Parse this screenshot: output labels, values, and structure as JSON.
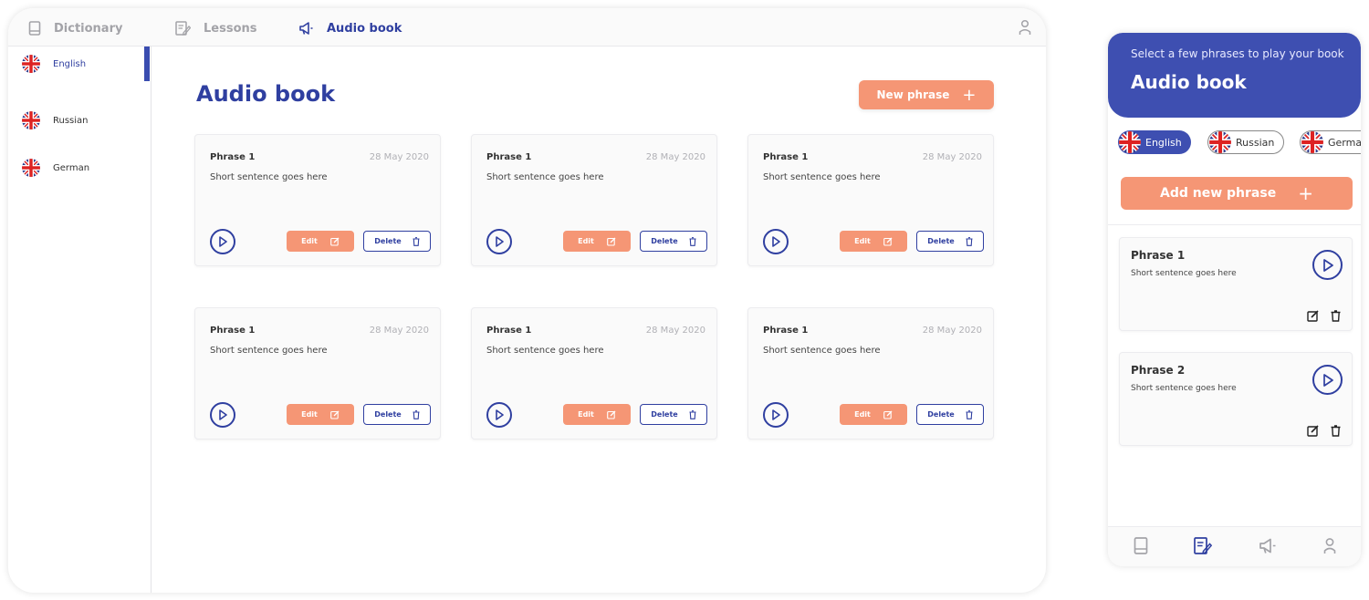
{
  "colors": {
    "brand": "#2f3fa0",
    "accent": "#f59675",
    "muted": "#a3a3a8",
    "mobile_header": "#3e4fb1"
  },
  "desktop": {
    "nav": [
      {
        "label": "Dictionary",
        "icon": "book-icon"
      },
      {
        "label": "Lessons",
        "icon": "edit-note-icon"
      },
      {
        "label": "Audio book",
        "icon": "megaphone-icon"
      }
    ],
    "user_icon": "user-icon",
    "sidebar": [
      {
        "label": "English",
        "icon": "uk-flag-icon"
      },
      {
        "label": "Russian",
        "icon": "uk-flag-icon"
      },
      {
        "label": "German",
        "icon": "uk-flag-icon"
      }
    ],
    "page_title": "Audio book",
    "new_button": "New phrase",
    "cards": [
      {
        "title": "Phrase 1",
        "date": "28 May 2020",
        "text": "Short sentence goes here",
        "edit": "Edit",
        "delete": "Delete"
      },
      {
        "title": "Phrase 1",
        "date": "28 May 2020",
        "text": "Short sentence goes here",
        "edit": "Edit",
        "delete": "Delete"
      },
      {
        "title": "Phrase 1",
        "date": "28 May 2020",
        "text": "Short sentence goes here",
        "edit": "Edit",
        "delete": "Delete"
      },
      {
        "title": "Phrase 1",
        "date": "28 May 2020",
        "text": "Short sentence goes here",
        "edit": "Edit",
        "delete": "Delete"
      },
      {
        "title": "Phrase 1",
        "date": "28 May 2020",
        "text": "Short sentence goes here",
        "edit": "Edit",
        "delete": "Delete"
      },
      {
        "title": "Phrase 1",
        "date": "28 May 2020",
        "text": "Short sentence goes here",
        "edit": "Edit",
        "delete": "Delete"
      }
    ]
  },
  "mobile": {
    "subtitle": "Select a few phrases to play your book",
    "title": "Audio book",
    "chips": [
      "English",
      "Russian",
      "Germa"
    ],
    "add_button": "Add new phrase",
    "cards": [
      {
        "title": "Phrase 1",
        "text": "Short sentence goes here"
      },
      {
        "title": "Phrase 2",
        "text": "Short sentence goes here"
      }
    ],
    "tabs": [
      "book-icon",
      "edit-note-icon",
      "megaphone-icon",
      "user-icon"
    ]
  }
}
